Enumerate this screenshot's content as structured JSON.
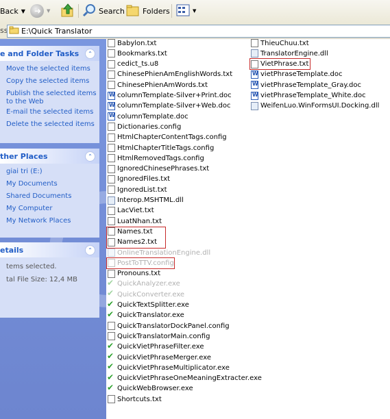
{
  "toolbar": {
    "back_label": "Back",
    "search_label": "Search",
    "folders_label": "Folders"
  },
  "address": {
    "label": "ss",
    "path": "E:\\Quick Translator"
  },
  "tasks": {
    "title": "e and Folder Tasks",
    "items": [
      "Move the selected items",
      "Copy the selected items",
      "Publish the selected items",
      "to the Web",
      "E-mail the selected items",
      "Delete the selected items"
    ]
  },
  "other": {
    "title": "ther Places",
    "items": [
      "giai tri (E:)",
      "My Documents",
      "Shared Documents",
      "My Computer",
      "My Network Places"
    ]
  },
  "details": {
    "title": "etails",
    "selected": "tems selected.",
    "size": "tal File Size: 12,4 MB"
  },
  "files_col1": [
    {
      "name": "Babylon.txt",
      "type": "txt"
    },
    {
      "name": "Bookmarks.txt",
      "type": "txt"
    },
    {
      "name": "cedict_ts.u8",
      "type": "u8"
    },
    {
      "name": "ChinesePhienAmEnglishWords.txt",
      "type": "txt"
    },
    {
      "name": "ChinesePhienAmWords.txt",
      "type": "txt"
    },
    {
      "name": "columnTemplate-Silver+Print.doc",
      "type": "doc"
    },
    {
      "name": "columnTemplate-Silver+Web.doc",
      "type": "doc"
    },
    {
      "name": "columnTemplate.doc",
      "type": "doc"
    },
    {
      "name": "Dictionaries.config",
      "type": "config"
    },
    {
      "name": "HtmlChapterContentTags.config",
      "type": "config"
    },
    {
      "name": "HtmlChapterTitleTags.config",
      "type": "config"
    },
    {
      "name": "HtmlRemovedTags.config",
      "type": "config"
    },
    {
      "name": "IgnoredChinesePhrases.txt",
      "type": "txt"
    },
    {
      "name": "IgnoredFiles.txt",
      "type": "txt"
    },
    {
      "name": "IgnoredList.txt",
      "type": "txt"
    },
    {
      "name": "Interop.MSHTML.dll",
      "type": "dll"
    },
    {
      "name": "LacViet.txt",
      "type": "txt"
    },
    {
      "name": "LuatNhan.txt",
      "type": "txt"
    },
    {
      "name": "Names.txt",
      "type": "txt"
    },
    {
      "name": "Names2.txt",
      "type": "txt"
    },
    {
      "name": "OnlineTranslationEngine.dll",
      "type": "dll",
      "grey": true
    },
    {
      "name": "PostToTTV.config",
      "type": "config",
      "grey": true
    },
    {
      "name": "Pronouns.txt",
      "type": "txt"
    },
    {
      "name": "QuickAnalyzer.exe",
      "type": "exe",
      "grey": true
    },
    {
      "name": "QuickConverter.exe",
      "type": "exe",
      "grey": true
    },
    {
      "name": "QuickTextSplitter.exe",
      "type": "exe"
    },
    {
      "name": "QuickTranslator.exe",
      "type": "exe"
    },
    {
      "name": "QuickTranslatorDockPanel.config",
      "type": "config"
    },
    {
      "name": "QuickTranslatorMain.config",
      "type": "config"
    },
    {
      "name": "QuickVietPhraseFilter.exe",
      "type": "exe"
    },
    {
      "name": "QuickVietPhraseMerger.exe",
      "type": "exe"
    },
    {
      "name": "QuickVietPhraseMultiplicator.exe",
      "type": "exe"
    },
    {
      "name": "QuickVietPhraseOneMeaningExtracter.exe",
      "type": "exe"
    },
    {
      "name": "QuickWebBrowser.exe",
      "type": "exe"
    },
    {
      "name": "Shortcuts.txt",
      "type": "txt"
    }
  ],
  "files_col2": [
    {
      "name": "ThieuChuu.txt",
      "type": "txt"
    },
    {
      "name": "TranslatorEngine.dll",
      "type": "dll"
    },
    {
      "name": "VietPhrase.txt",
      "type": "txt"
    },
    {
      "name": "vietPhraseTemplate.doc",
      "type": "doc"
    },
    {
      "name": "vietPhraseTemplate_Gray.doc",
      "type": "doc"
    },
    {
      "name": "vietPhraseTemplate_White.doc",
      "type": "doc"
    },
    {
      "name": "WeifenLuo.WinFormsUI.Docking.dll",
      "type": "dll"
    }
  ],
  "colors": {
    "accent": "#215dc6",
    "panel": "#7a96df",
    "highlight": "#c62828",
    "exe_check": "#2ea12e"
  }
}
